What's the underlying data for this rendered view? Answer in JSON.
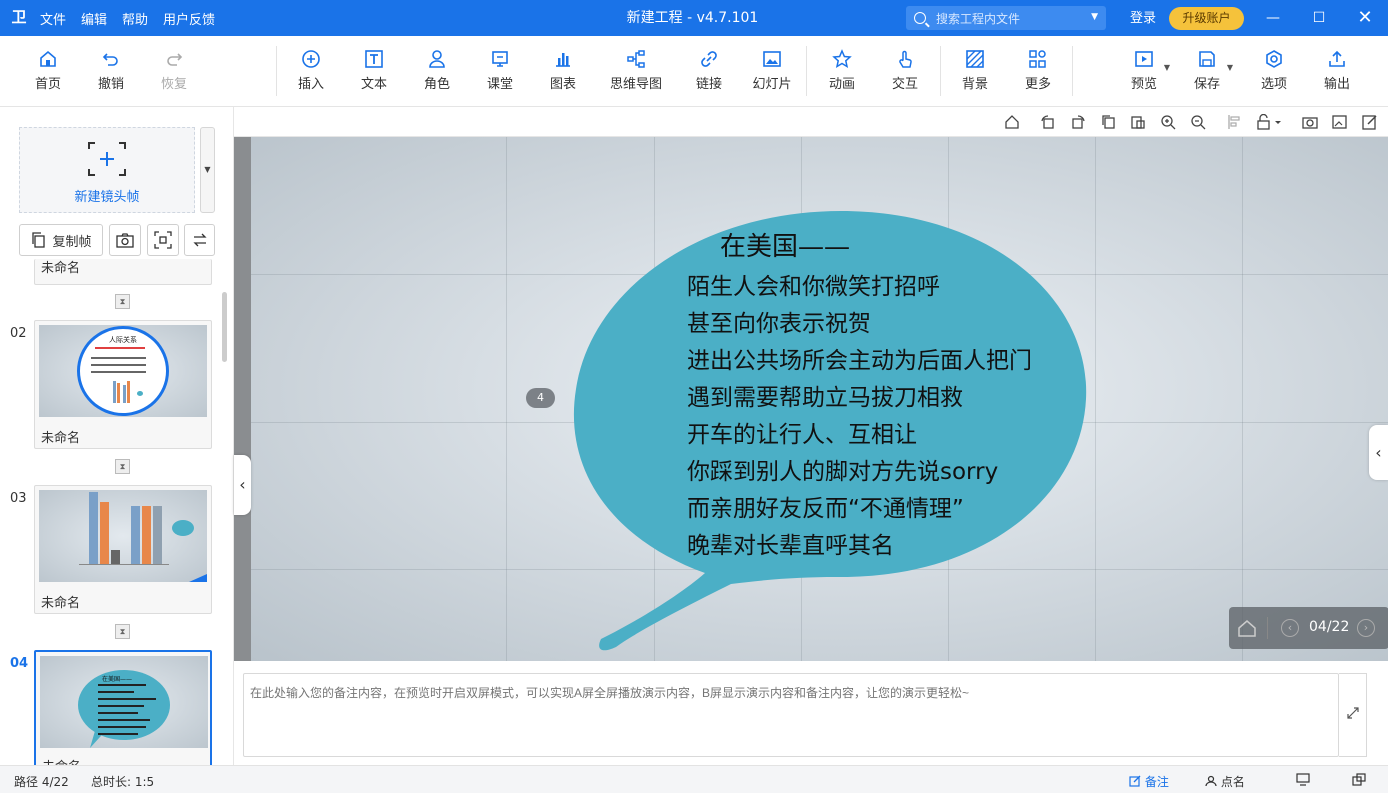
{
  "titlebar": {
    "menu": [
      "文件",
      "编辑",
      "帮助",
      "用户反馈"
    ],
    "title": "新建工程 - v4.7.101",
    "search_placeholder": "搜索工程内文件",
    "login": "登录",
    "upgrade": "升级账户"
  },
  "toolbar": {
    "home": "首页",
    "undo": "撤销",
    "redo": "恢复",
    "insert": "插入",
    "text": "文本",
    "role": "角色",
    "classroom": "课堂",
    "chart": "图表",
    "mindmap": "思维导图",
    "link": "链接",
    "slides": "幻灯片",
    "animation": "动画",
    "interact": "交互",
    "background": "背景",
    "more": "更多",
    "preview": "预览",
    "save": "保存",
    "options": "选项",
    "export": "输出"
  },
  "sidebar": {
    "new_frame": "新建镜头帧",
    "copy_frame": "复制帧",
    "partial_name": "未命名",
    "frames": [
      {
        "index": "02",
        "name": "未命名"
      },
      {
        "index": "03",
        "name": "未命名"
      },
      {
        "index": "04",
        "name": "未命名"
      }
    ]
  },
  "slide": {
    "title": "在美国——",
    "lines": [
      "陌生人会和你微笑打招呼",
      "甚至向你表示祝贺",
      "进出公共场所会主动为后面人把门",
      "遇到需要帮助立马拔刀相救",
      "开车的让行人、互相让",
      "你踩到别人的脚对方先说sorry",
      "而亲朋好友反而“不通情理”",
      "晚辈对长辈直呼其名"
    ],
    "frame_badge": "4",
    "bubble_color": "#4bafc6"
  },
  "pager": {
    "current": "04/22"
  },
  "notes": {
    "placeholder": "在此处输入您的备注内容，在预览时开启双屏模式，可以实现A屏全屏播放演示内容，B屏显示演示内容和备注内容，让您的演示更轻松~"
  },
  "status": {
    "path": "路径 4/22",
    "duration": "总时长: 1:5",
    "notes": "备注",
    "rollcall": "点名"
  },
  "thumbs": {
    "t2_title": "人际关系",
    "t3_legend": "",
    "t4_title": "在美国——"
  },
  "colors": {
    "accent": "#1a73e8",
    "upgrade": "#f5c23b"
  }
}
